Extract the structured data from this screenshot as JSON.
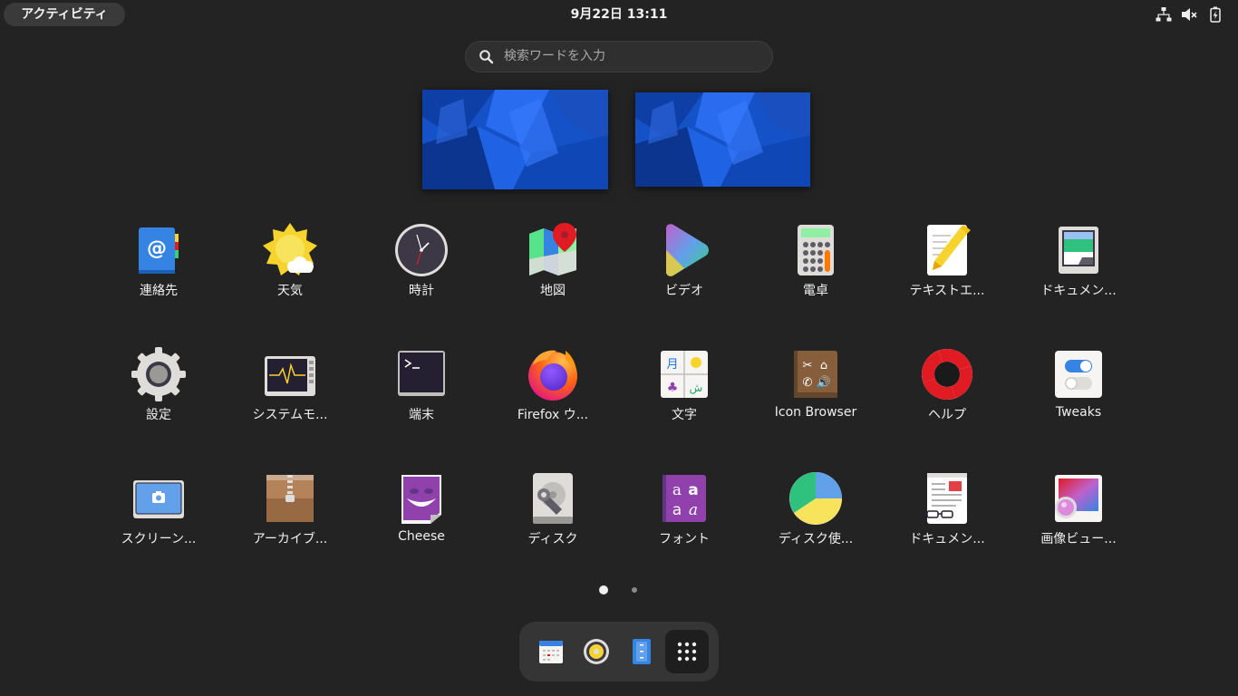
{
  "topbar": {
    "activities_label": "アクティビティ",
    "clock": "9月22日  13:11",
    "tray_icons": [
      "network-icon",
      "volume-muted-icon",
      "battery-icon"
    ]
  },
  "search": {
    "placeholder": "検索ワードを入力"
  },
  "workspaces": [
    "workspace-1",
    "workspace-2"
  ],
  "apps": [
    {
      "label": "連絡先",
      "icon": "contacts-icon"
    },
    {
      "label": "天気",
      "icon": "weather-icon"
    },
    {
      "label": "時計",
      "icon": "clock-icon"
    },
    {
      "label": "地図",
      "icon": "maps-icon"
    },
    {
      "label": "ビデオ",
      "icon": "video-icon"
    },
    {
      "label": "電卓",
      "icon": "calculator-icon"
    },
    {
      "label": "テキストエ...",
      "icon": "text-editor-icon"
    },
    {
      "label": "ドキュメン...",
      "icon": "document-scanner-icon"
    },
    {
      "label": "設定",
      "icon": "settings-gear-icon"
    },
    {
      "label": "システムモ...",
      "icon": "system-monitor-icon"
    },
    {
      "label": "端末",
      "icon": "terminal-icon"
    },
    {
      "label": "Firefox ウ...",
      "icon": "firefox-icon"
    },
    {
      "label": "文字",
      "icon": "characters-icon"
    },
    {
      "label": "Icon Browser",
      "icon": "icon-browser-icon"
    },
    {
      "label": "ヘルプ",
      "icon": "help-lifebuoy-icon"
    },
    {
      "label": "Tweaks",
      "icon": "tweaks-icon"
    },
    {
      "label": "スクリーン...",
      "icon": "screenshot-icon"
    },
    {
      "label": "アーカイブ...",
      "icon": "archive-manager-icon"
    },
    {
      "label": "Cheese",
      "icon": "cheese-icon"
    },
    {
      "label": "ディスク",
      "icon": "disks-icon"
    },
    {
      "label": "フォント",
      "icon": "fonts-icon"
    },
    {
      "label": "ディスク使...",
      "icon": "disk-usage-icon"
    },
    {
      "label": "ドキュメン...",
      "icon": "document-viewer-icon"
    },
    {
      "label": "画像ビュー...",
      "icon": "image-viewer-icon"
    }
  ],
  "pager": {
    "count": 2,
    "active": 0
  },
  "dock": [
    {
      "icon": "calendar-icon"
    },
    {
      "icon": "rhythmbox-icon"
    },
    {
      "icon": "files-icon"
    },
    {
      "icon": "show-apps-grid-icon"
    }
  ],
  "colors": {
    "background": "#232323",
    "wallpaper_blue": "#1b5fd8",
    "dock_bg": "#353535"
  }
}
